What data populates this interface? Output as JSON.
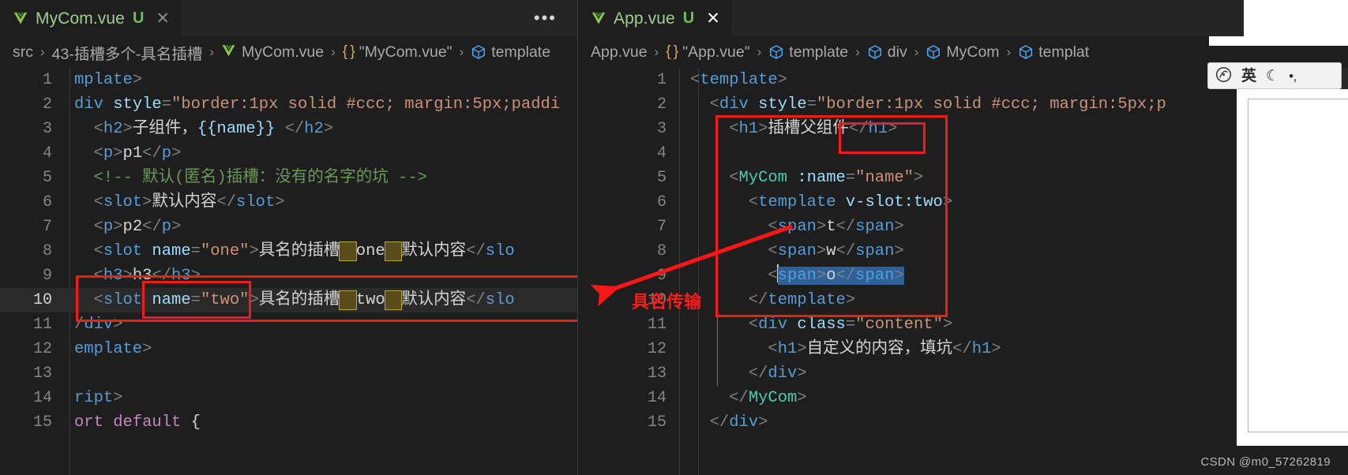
{
  "window": {
    "theme_bg": "#1e1e1e",
    "accent_red": "#f01b1b"
  },
  "left_pane": {
    "tab": {
      "icon": "vue-logo-icon",
      "name": "MyCom.vue",
      "badge": "U",
      "close": "✕"
    },
    "more_actions": "•••",
    "breadcrumb": [
      {
        "icon": "none",
        "text": "src"
      },
      {
        "icon": "none",
        "text": "43-插槽多个-具名插槽"
      },
      {
        "icon": "vue-logo-icon",
        "text": "MyCom.vue"
      },
      {
        "icon": "braces-icon",
        "text": "\"MyCom.vue\""
      },
      {
        "icon": "symbol-cube-icon",
        "text": "template"
      }
    ],
    "breadcrumb_separator": "›",
    "active_line": 10,
    "lines": [
      {
        "n": "1",
        "tokens": [
          {
            "t": "mplate",
            "c": "t-tag"
          },
          {
            "t": ">",
            "c": "t-brk"
          }
        ]
      },
      {
        "n": "2",
        "tokens": [
          {
            "t": "div ",
            "c": "t-tag"
          },
          {
            "t": "style",
            "c": "t-attr"
          },
          {
            "t": "=",
            "c": "t-brk"
          },
          {
            "t": "\"border:1px solid #ccc; margin:5px;paddi",
            "c": "t-str"
          }
        ]
      },
      {
        "n": "3",
        "tokens": [
          {
            "t": "  <",
            "c": "t-brk"
          },
          {
            "t": "h2",
            "c": "t-tag"
          },
          {
            "t": ">",
            "c": "t-brk"
          },
          {
            "t": "子组件，",
            "c": "t-txt"
          },
          {
            "t": "{{name}}",
            "c": "t-mus"
          },
          {
            "t": " ",
            "c": "t-txt"
          },
          {
            "t": "</",
            "c": "t-brk"
          },
          {
            "t": "h2",
            "c": "t-tag"
          },
          {
            "t": ">",
            "c": "t-brk"
          }
        ]
      },
      {
        "n": "4",
        "tokens": [
          {
            "t": "  <",
            "c": "t-brk"
          },
          {
            "t": "p",
            "c": "t-tag"
          },
          {
            "t": ">",
            "c": "t-brk"
          },
          {
            "t": "p1",
            "c": "t-txt"
          },
          {
            "t": "</",
            "c": "t-brk"
          },
          {
            "t": "p",
            "c": "t-tag"
          },
          {
            "t": ">",
            "c": "t-brk"
          }
        ]
      },
      {
        "n": "5",
        "tokens": [
          {
            "t": "  <!-- 默认(匿名)插槽：没有的名字的坑 -->",
            "c": "t-cmt"
          }
        ]
      },
      {
        "n": "6",
        "tokens": [
          {
            "t": "  <",
            "c": "t-brk"
          },
          {
            "t": "slot",
            "c": "t-tag"
          },
          {
            "t": ">",
            "c": "t-brk"
          },
          {
            "t": "默认内容",
            "c": "t-txt"
          },
          {
            "t": "</",
            "c": "t-brk"
          },
          {
            "t": "slot",
            "c": "t-tag"
          },
          {
            "t": ">",
            "c": "t-brk"
          }
        ]
      },
      {
        "n": "7",
        "tokens": [
          {
            "t": "  <",
            "c": "t-brk"
          },
          {
            "t": "p",
            "c": "t-tag"
          },
          {
            "t": ">",
            "c": "t-brk"
          },
          {
            "t": "p2",
            "c": "t-txt"
          },
          {
            "t": "</",
            "c": "t-brk"
          },
          {
            "t": "p",
            "c": "t-tag"
          },
          {
            "t": ">",
            "c": "t-brk"
          }
        ]
      },
      {
        "n": "8",
        "tokens": [
          {
            "t": "  <",
            "c": "t-brk"
          },
          {
            "t": "slot ",
            "c": "t-tag"
          },
          {
            "t": "name",
            "c": "t-attr"
          },
          {
            "t": "=",
            "c": "t-brk"
          },
          {
            "t": "\"one\"",
            "c": "t-str"
          },
          {
            "t": ">",
            "c": "t-brk"
          },
          {
            "t": "具名的插槽",
            "c": "t-txt"
          },
          {
            "t": "，",
            "c": "ws-mark"
          },
          {
            "t": "one",
            "c": "t-txt"
          },
          {
            "t": "，",
            "c": "ws-mark"
          },
          {
            "t": "默认内容",
            "c": "t-txt"
          },
          {
            "t": "</",
            "c": "t-brk"
          },
          {
            "t": "slo",
            "c": "t-tag"
          }
        ]
      },
      {
        "n": "9",
        "tokens": [
          {
            "t": "  <",
            "c": "t-brk"
          },
          {
            "t": "h3",
            "c": "t-tag"
          },
          {
            "t": ">",
            "c": "t-brk"
          },
          {
            "t": "h3",
            "c": "t-txt"
          },
          {
            "t": "</",
            "c": "t-brk"
          },
          {
            "t": "h3",
            "c": "t-tag"
          },
          {
            "t": ">",
            "c": "t-brk"
          }
        ]
      },
      {
        "n": "10",
        "tokens": [
          {
            "t": "  <",
            "c": "t-brk"
          },
          {
            "t": "slot ",
            "c": "t-tag"
          },
          {
            "t": "name",
            "c": "t-attr"
          },
          {
            "t": "=",
            "c": "t-brk"
          },
          {
            "t": "\"two\"",
            "c": "t-str"
          },
          {
            "t": ">",
            "c": "t-brk"
          },
          {
            "t": "具名的插槽",
            "c": "t-txt"
          },
          {
            "t": "，",
            "c": "ws-mark"
          },
          {
            "t": "two",
            "c": "t-txt"
          },
          {
            "t": "，",
            "c": "ws-mark"
          },
          {
            "t": "默认内容",
            "c": "t-txt"
          },
          {
            "t": "</",
            "c": "t-brk"
          },
          {
            "t": "slo",
            "c": "t-tag"
          }
        ]
      },
      {
        "n": "11",
        "tokens": [
          {
            "t": "/",
            "c": "t-brk"
          },
          {
            "t": "div",
            "c": "t-tag"
          },
          {
            "t": ">",
            "c": "t-brk"
          }
        ]
      },
      {
        "n": "12",
        "tokens": [
          {
            "t": "emplate",
            "c": "t-tag"
          },
          {
            "t": ">",
            "c": "t-brk"
          }
        ]
      },
      {
        "n": "13",
        "tokens": []
      },
      {
        "n": "14",
        "tokens": [
          {
            "t": "ript",
            "c": "t-tag"
          },
          {
            "t": ">",
            "c": "t-brk"
          }
        ]
      },
      {
        "n": "15",
        "tokens": [
          {
            "t": "ort ",
            "c": "t-kw"
          },
          {
            "t": "default",
            "c": "t-kw"
          },
          {
            "t": " {",
            "c": "t-txt"
          }
        ]
      }
    ],
    "annotations": {
      "outer_box_label": "line-10-outer-highlight",
      "inner_box_label": "name-two-attribute-highlight"
    }
  },
  "right_pane": {
    "tab": {
      "icon": "vue-logo-icon",
      "name": "App.vue",
      "badge": "U",
      "close": "✕"
    },
    "breadcrumb": [
      {
        "icon": "none",
        "text": "App.vue"
      },
      {
        "icon": "braces-icon",
        "text": "\"App.vue\""
      },
      {
        "icon": "symbol-cube-icon",
        "text": "template"
      },
      {
        "icon": "symbol-cube-icon",
        "text": "div"
      },
      {
        "icon": "symbol-cube-icon",
        "text": "MyCom"
      },
      {
        "icon": "symbol-cube-icon",
        "text": "templat"
      }
    ],
    "breadcrumb_separator": "›",
    "lines": [
      {
        "n": "1",
        "tokens": [
          {
            "t": "<",
            "c": "t-brk"
          },
          {
            "t": "template",
            "c": "t-tag"
          },
          {
            "t": ">",
            "c": "t-brk"
          }
        ]
      },
      {
        "n": "2",
        "tokens": [
          {
            "t": "  <",
            "c": "t-brk"
          },
          {
            "t": "div ",
            "c": "t-tag"
          },
          {
            "t": "style",
            "c": "t-attr"
          },
          {
            "t": "=",
            "c": "t-brk"
          },
          {
            "t": "\"border:1px solid #ccc; margin:5px;p",
            "c": "t-str"
          }
        ]
      },
      {
        "n": "3",
        "tokens": [
          {
            "t": "    <",
            "c": "t-brk"
          },
          {
            "t": "h1",
            "c": "t-tag"
          },
          {
            "t": ">",
            "c": "t-brk"
          },
          {
            "t": "插槽父组件",
            "c": "t-txt"
          },
          {
            "t": "</",
            "c": "t-brk"
          },
          {
            "t": "h1",
            "c": "t-tag"
          },
          {
            "t": ">",
            "c": "t-brk"
          }
        ]
      },
      {
        "n": "4",
        "tokens": []
      },
      {
        "n": "5",
        "tokens": [
          {
            "t": "    <",
            "c": "t-brk"
          },
          {
            "t": "MyCom",
            "c": "t-comp"
          },
          {
            "t": " :",
            "c": "t-attr"
          },
          {
            "t": "name",
            "c": "t-attr"
          },
          {
            "t": "=",
            "c": "t-brk"
          },
          {
            "t": "\"name\"",
            "c": "t-str"
          },
          {
            "t": ">",
            "c": "t-brk"
          }
        ]
      },
      {
        "n": "6",
        "tokens": [
          {
            "t": "      <",
            "c": "t-brk"
          },
          {
            "t": "template ",
            "c": "t-tag"
          },
          {
            "t": "v-slot:two",
            "c": "t-attr"
          },
          {
            "t": ">",
            "c": "t-brk"
          }
        ]
      },
      {
        "n": "7",
        "tokens": [
          {
            "t": "        <",
            "c": "t-brk"
          },
          {
            "t": "span",
            "c": "t-tag"
          },
          {
            "t": ">",
            "c": "t-brk"
          },
          {
            "t": "t",
            "c": "t-txt"
          },
          {
            "t": "</",
            "c": "t-brk"
          },
          {
            "t": "span",
            "c": "t-tag"
          },
          {
            "t": ">",
            "c": "t-brk"
          }
        ]
      },
      {
        "n": "8",
        "tokens": [
          {
            "t": "        <",
            "c": "t-brk"
          },
          {
            "t": "span",
            "c": "t-tag"
          },
          {
            "t": ">",
            "c": "t-brk"
          },
          {
            "t": "w",
            "c": "t-txt"
          },
          {
            "t": "</",
            "c": "t-brk"
          },
          {
            "t": "span",
            "c": "t-tag"
          },
          {
            "t": ">",
            "c": "t-brk"
          }
        ]
      },
      {
        "n": "9",
        "tokens": [
          {
            "t": "        <",
            "c": "t-brk"
          },
          {
            "t": "span",
            "c": "t-tag"
          },
          {
            "t": ">",
            "c": "t-brk"
          },
          {
            "t": "o",
            "c": "t-txt"
          },
          {
            "t": "</",
            "c": "t-brk"
          },
          {
            "t": "span",
            "c": "t-tag"
          },
          {
            "t": ">",
            "c": "t-brk"
          }
        ]
      },
      {
        "n": "10",
        "tokens": [
          {
            "t": "      </",
            "c": "t-brk"
          },
          {
            "t": "template",
            "c": "t-tag"
          },
          {
            "t": ">",
            "c": "t-brk"
          }
        ]
      },
      {
        "n": "11",
        "tokens": [
          {
            "t": "      <",
            "c": "t-brk"
          },
          {
            "t": "div ",
            "c": "t-tag"
          },
          {
            "t": "class",
            "c": "t-attr"
          },
          {
            "t": "=",
            "c": "t-brk"
          },
          {
            "t": "\"content\"",
            "c": "t-str"
          },
          {
            "t": ">",
            "c": "t-brk"
          }
        ]
      },
      {
        "n": "12",
        "tokens": [
          {
            "t": "        <",
            "c": "t-brk"
          },
          {
            "t": "h1",
            "c": "t-tag"
          },
          {
            "t": ">",
            "c": "t-brk"
          },
          {
            "t": "自定义的内容，填坑",
            "c": "t-txt"
          },
          {
            "t": "</",
            "c": "t-brk"
          },
          {
            "t": "h1",
            "c": "t-tag"
          },
          {
            "t": ">",
            "c": "t-brk"
          }
        ]
      },
      {
        "n": "13",
        "tokens": [
          {
            "t": "      </",
            "c": "t-brk"
          },
          {
            "t": "div",
            "c": "t-tag"
          },
          {
            "t": ">",
            "c": "t-brk"
          }
        ]
      },
      {
        "n": "14",
        "tokens": [
          {
            "t": "    </",
            "c": "t-brk"
          },
          {
            "t": "MyCom",
            "c": "t-comp"
          },
          {
            "t": ">",
            "c": "t-brk"
          }
        ]
      },
      {
        "n": "15",
        "tokens": [
          {
            "t": "  </",
            "c": "t-brk"
          },
          {
            "t": "div",
            "c": "t-tag"
          },
          {
            "t": ">",
            "c": "t-brk"
          }
        ]
      }
    ],
    "selection_line": 9,
    "annotations": {
      "outer_box_label": "template-v-slot-block-highlight",
      "inner_box_label": "v-slot-two-highlight"
    }
  },
  "annotation": {
    "arrow_label": "具名传输",
    "color": "#ff1a1a"
  },
  "ime": {
    "items": [
      "◔",
      "英",
      "☾",
      "•‚"
    ],
    "language_label": "英"
  },
  "watermark": "CSDN @m0_57262819"
}
